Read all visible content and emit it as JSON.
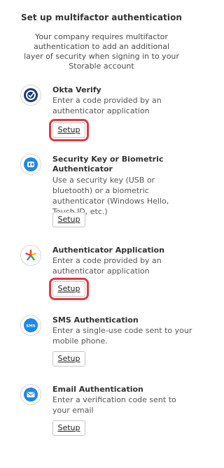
{
  "header": {
    "title": "Set up multifactor authentication",
    "description": "Your company requires multifactor authentication to add an additional layer of security when signing in to your Storable account"
  },
  "factors": [
    {
      "name": "Okta Verify",
      "description": "Enter a code provided by an authenticator application",
      "button": "Setup",
      "icon": "okta-verify-icon",
      "highlighted": true
    },
    {
      "name": "Security Key or Biometric Authenticator",
      "description": "Use a security key (USB or bluetooth) or a biometric authenticator (Windows Hello, Touch ID, etc.)",
      "button": "Setup",
      "icon": "security-key-icon",
      "highlighted": false
    },
    {
      "name": "Authenticator Application",
      "description": "Enter a code provided by an authenticator application",
      "button": "Setup",
      "icon": "authenticator-app-icon",
      "highlighted": true
    },
    {
      "name": "SMS Authentication",
      "description": "Enter a single-use code sent to your mobile phone.",
      "button": "Setup",
      "icon": "sms-icon",
      "icon_text": "SMS",
      "highlighted": false
    },
    {
      "name": "Email Authentication",
      "description": "Enter a verification code sent to your email",
      "button": "Setup",
      "icon": "email-icon",
      "highlighted": false
    }
  ],
  "colors": {
    "highlight": "#e03a45",
    "okta_blue": "#1a3a7a",
    "sms_blue": "#1e88e5",
    "email_blue": "#1e88e5"
  }
}
